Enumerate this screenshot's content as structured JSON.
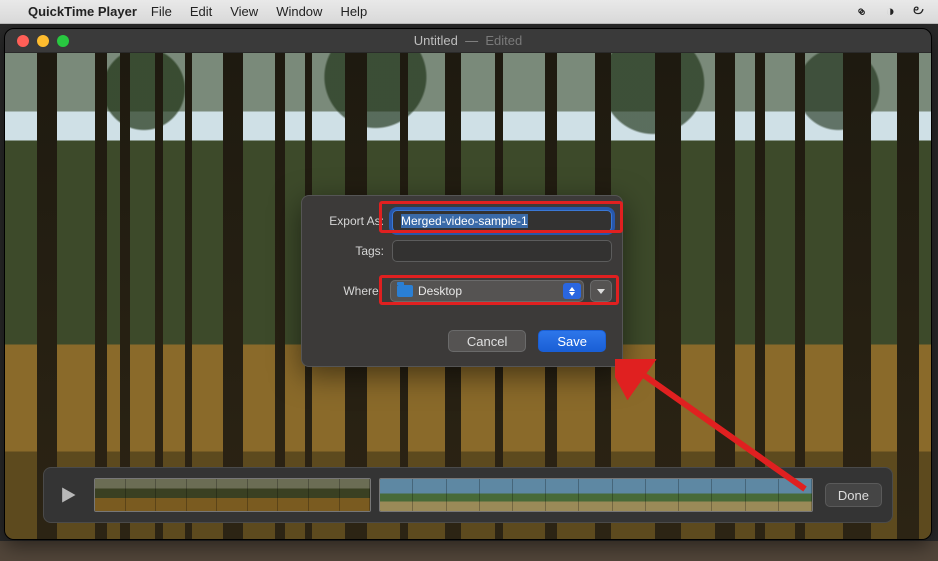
{
  "menubar": {
    "app_name": "QuickTime Player",
    "items": [
      "File",
      "Edit",
      "View",
      "Window",
      "Help"
    ],
    "right_icons": [
      "paperclip-icon",
      "moon-icon",
      "swirl-icon"
    ]
  },
  "window": {
    "title": "Untitled",
    "title_suffix": "Edited"
  },
  "dialog": {
    "export_label": "Export As:",
    "export_value": "Merged-video-sample-1",
    "tags_label": "Tags:",
    "tags_value": "",
    "where_label": "Where:",
    "where_value": "Desktop",
    "cancel_label": "Cancel",
    "save_label": "Save"
  },
  "timeline": {
    "done_label": "Done"
  }
}
